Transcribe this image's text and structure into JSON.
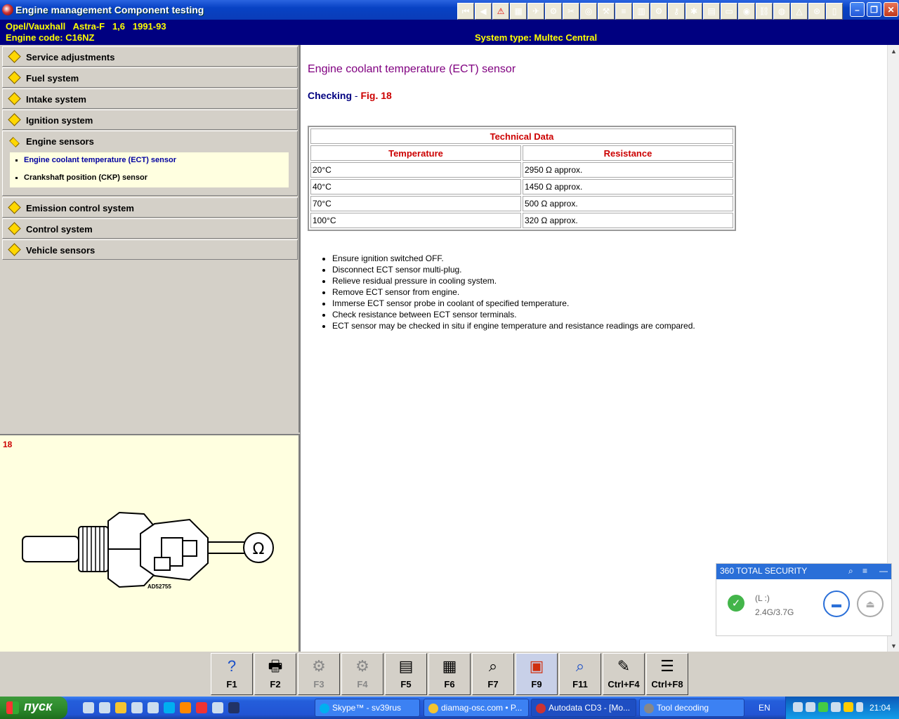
{
  "window": {
    "title": "Engine management Component testing"
  },
  "header": {
    "vehicle": "Opel/Vauxhall   Astra-F   1,6   1991-93",
    "engine_code": "Engine code: C16NZ",
    "system_type": "System type: Multec Central"
  },
  "sidebar": {
    "categories": [
      {
        "label": "Service adjustments"
      },
      {
        "label": "Fuel system"
      },
      {
        "label": "Intake system"
      },
      {
        "label": "Ignition system"
      },
      {
        "label": "Engine sensors"
      },
      {
        "label": "Emission control system"
      },
      {
        "label": "Control system"
      },
      {
        "label": "Vehicle sensors"
      }
    ],
    "sub_items": [
      {
        "label": "Engine coolant temperature (ECT) sensor"
      },
      {
        "label": "Crankshaft position (CKP) sensor"
      }
    ]
  },
  "figure": {
    "number": "18",
    "code": "AD52755",
    "omega": "Ω"
  },
  "content": {
    "title": "Engine coolant temperature (ECT) sensor",
    "checking": "Checking",
    "checking_sep": " - ",
    "checking_fig": "Fig. 18",
    "table": {
      "title": "Technical Data",
      "headers": [
        "Temperature",
        "Resistance"
      ],
      "rows": [
        [
          "20°C",
          "2950 Ω approx."
        ],
        [
          "40°C",
          "1450 Ω approx."
        ],
        [
          "70°C",
          "500 Ω approx."
        ],
        [
          "100°C",
          "320 Ω approx."
        ]
      ]
    },
    "steps": [
      "Ensure ignition switched OFF.",
      "Disconnect ECT sensor multi-plug.",
      "Relieve residual pressure in cooling system.",
      "Remove ECT sensor from engine.",
      "Immerse ECT sensor probe in coolant of specified temperature.",
      "Check resistance between ECT sensor terminals.",
      "ECT sensor may be checked in situ if engine temperature and resistance readings are compared."
    ]
  },
  "function_keys": [
    {
      "key": "F1",
      "icon": "help-icon",
      "glyph": "?",
      "enabled": true
    },
    {
      "key": "F2",
      "icon": "printer-icon",
      "glyph": "🖶",
      "enabled": true
    },
    {
      "key": "F3",
      "icon": "component-location-icon",
      "glyph": "⚙",
      "enabled": false
    },
    {
      "key": "F4",
      "icon": "component-view-icon",
      "glyph": "⚙",
      "enabled": false
    },
    {
      "key": "F5",
      "icon": "wiring-diagram-icon",
      "glyph": "▤",
      "enabled": true
    },
    {
      "key": "F6",
      "icon": "pin-data-icon",
      "glyph": "▦",
      "enabled": true
    },
    {
      "key": "F7",
      "icon": "magnify-icon",
      "glyph": "⌕",
      "enabled": true
    },
    {
      "key": "F9",
      "icon": "fault-codes-icon",
      "glyph": "▣",
      "enabled": true
    },
    {
      "key": "F11",
      "icon": "search-icon",
      "glyph": "⌕",
      "enabled": true
    },
    {
      "key": "Ctrl+F4",
      "icon": "notes-icon",
      "glyph": "✎",
      "enabled": true
    },
    {
      "key": "Ctrl+F8",
      "icon": "list-icon",
      "glyph": "☰",
      "enabled": true
    }
  ],
  "security_widget": {
    "title": "360 TOTAL SECURITY",
    "drive": "(L :)",
    "usage": "2.4G/3.7G"
  },
  "taskbar": {
    "start": "пуск",
    "tasks": [
      {
        "label": "Skype™ - sv39rus"
      },
      {
        "label": "diamag-osc.com • P..."
      },
      {
        "label": "Autodata CD3 - [Mo..."
      },
      {
        "label": "Tool decoding"
      }
    ],
    "language": "EN",
    "clock": "21:04"
  },
  "colors": {
    "title_bar": "#0842c4",
    "info_bar": "#000080",
    "info_text": "#ffff00",
    "heading": "#800080",
    "accent_red": "#cc0000"
  }
}
